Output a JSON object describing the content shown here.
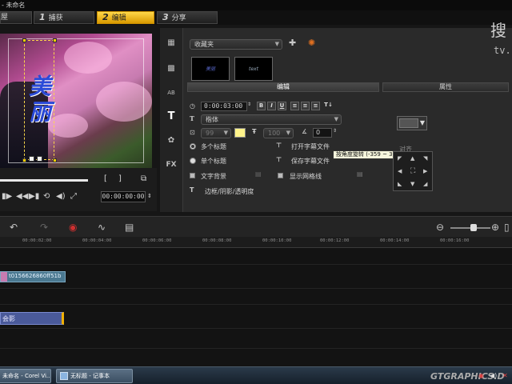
{
  "window": {
    "title": "- 未命名"
  },
  "steps": [
    {
      "num": "",
      "label": "捕获",
      "prefix": "屋"
    },
    {
      "num": "1",
      "label": "捕获"
    },
    {
      "num": "2",
      "label": "编辑"
    },
    {
      "num": "3",
      "label": "分享"
    }
  ],
  "preview": {
    "title_text": "美丽",
    "timecode": "00:00:00:00"
  },
  "side_icons": [
    "media-icon",
    "transition-icon",
    "title-icon",
    "graphics-icon",
    "filter-icon",
    "fx-icon"
  ],
  "side_icon_glyphs": [
    "▦",
    "▩",
    "AB",
    "T",
    "✿",
    "FX"
  ],
  "library": {
    "dropdown": "收藏夹",
    "thumbs": [
      "美丽",
      "text"
    ]
  },
  "tabs": {
    "edit": "编辑",
    "attributes": "属性"
  },
  "edit": {
    "duration": "0:00:03:00",
    "font": "楷体",
    "size": "99",
    "line_spacing": "100",
    "angle": "0",
    "multi_title": "多个标题",
    "single_title": "单个标题",
    "text_background": "文字背景",
    "border_shadow": "边框/阴影/透明度",
    "open_subtitle": "打开字幕文件",
    "save_subtitle": "保存字幕文件",
    "show_grid": "显示网格线",
    "align_label": "对齐",
    "tooltip": "按角度旋转 (-359 ~ 359)",
    "format_buttons": [
      "B",
      "I",
      "U",
      "≡",
      "≡",
      "≡",
      "T↓"
    ]
  },
  "watermark": {
    "chars": "搜",
    "text": "tv."
  },
  "ruler": {
    "ticks": [
      "00:00:02:00",
      "00:00:04:00",
      "00:00:06:00",
      "00:00:08:00",
      "00:00:10:00",
      "00:00:12:00",
      "00:00:14:00",
      "00:00:16:00"
    ]
  },
  "timeline": {
    "video_clip": "t0156626860ff51b",
    "title_clip": "会影"
  },
  "taskbar": {
    "tasks": [
      "未命名 - Corel Vi...",
      "无标题 - 记事本"
    ],
    "logo": "GTGRAPHICS.D"
  }
}
